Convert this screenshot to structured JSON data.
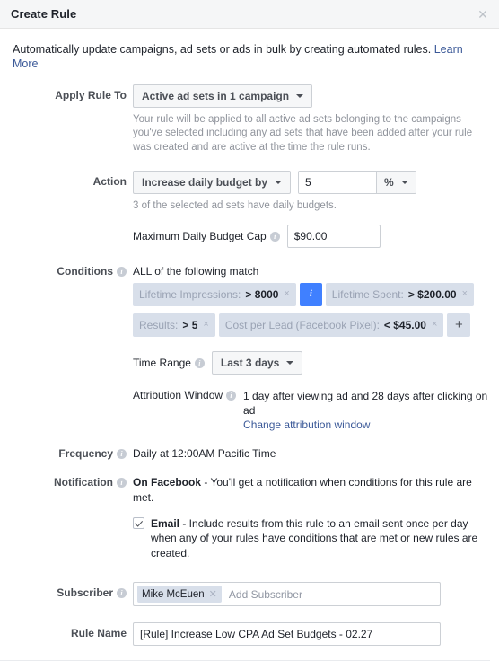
{
  "header": {
    "title": "Create Rule",
    "close_icon": "close-icon"
  },
  "intro": {
    "text": "Automatically update campaigns, ad sets or ads in bulk by creating automated rules.",
    "link_label": "Learn More"
  },
  "apply_rule_to": {
    "label": "Apply Rule To",
    "selected": "Active ad sets in 1 campaign",
    "help": "Your rule will be applied to all active ad sets belonging to the campaigns you've selected including any ad sets that have been added after your rule was created and are active at the time the rule runs."
  },
  "action": {
    "label": "Action",
    "selected": "Increase daily budget by",
    "amount": "5",
    "unit": "%",
    "help": "3 of the selected ad sets have daily budgets.",
    "budget_cap_label": "Maximum Daily Budget Cap",
    "budget_cap_value": "$90.00"
  },
  "conditions": {
    "label": "Conditions",
    "match_text": "ALL of the following match",
    "chips": [
      {
        "name": "Lifetime Impressions:",
        "value": "> 8000"
      },
      {
        "name": "Lifetime Spent:",
        "value": "> $200.00"
      },
      {
        "name": "Results:",
        "value": "> 5"
      },
      {
        "name": "Cost per Lead (Facebook Pixel):",
        "value": "< $45.00"
      }
    ],
    "info_badge": "i",
    "add_label": "+",
    "remove_label": "×"
  },
  "time_range": {
    "label": "Time Range",
    "selected": "Last 3 days"
  },
  "attribution": {
    "label": "Attribution Window",
    "value": "1 day after viewing ad and 28 days after clicking on ad",
    "link_label": "Change attribution window"
  },
  "frequency": {
    "label": "Frequency",
    "value": "Daily at 12:00AM Pacific Time"
  },
  "notification": {
    "label": "Notification",
    "on_facebook_bold": "On Facebook",
    "on_facebook_rest": " - You'll get a notification when conditions for this rule are met.",
    "email_bold": "Email",
    "email_rest": " - Include results from this rule to an email sent once per day when any of your rules have conditions that are met or new rules are created.",
    "email_checked": true
  },
  "subscriber": {
    "label": "Subscriber",
    "tokens": [
      "Mike McEuen"
    ],
    "placeholder": "Add Subscriber"
  },
  "rule_name": {
    "label": "Rule Name",
    "value": "[Rule] Increase Low CPA Ad Set Budgets - 02.27"
  },
  "colors": {
    "accent_blue": "#4080ff",
    "link_blue": "#3b5998",
    "chip_bg": "#d8dfea",
    "header_bg": "#f5f6f7"
  }
}
